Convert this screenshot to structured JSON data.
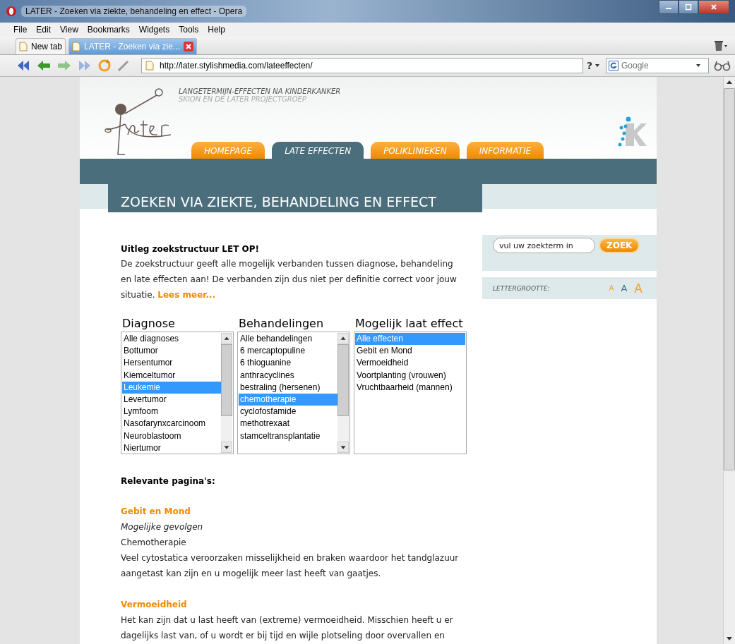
{
  "window": {
    "title": "LATER - Zoeken via ziekte, behandeling en effect - Opera"
  },
  "menu": [
    "File",
    "Edit",
    "View",
    "Bookmarks",
    "Widgets",
    "Tools",
    "Help"
  ],
  "browser_tabs": [
    {
      "label": "New tab",
      "selected": false
    },
    {
      "label": "LATER - Zoeken via zie...",
      "selected": true
    }
  ],
  "address": {
    "url": "http://later.stylishmedia.com/lateeffecten/"
  },
  "help_button": "?",
  "search": {
    "placeholder": "Google"
  },
  "site": {
    "tagline": "LANGETERMIJN-EFFECTEN NA KINDERKANKER",
    "subtagline": "SKION EN DE LATER PROJECTGROEP",
    "nav": [
      {
        "label": "HOMEPAGE",
        "selected": false
      },
      {
        "label": "LATE EFFECTEN",
        "selected": true
      },
      {
        "label": "POLIKLINIEKEN",
        "selected": false
      },
      {
        "label": "INFORMATIE",
        "selected": false
      }
    ],
    "page_title": "ZOEKEN VIA ZIEKTE, BEHANDELING EN EFFECT"
  },
  "intro": {
    "heading": "Uitleg zoekstructuur LET OP!",
    "text": "De zoekstructuur geeft alle mogelijk verbanden tussen diagnose, behandeling en late effecten aan! De verbanden zijn dus niet per definitie correct voor jouw situatie.",
    "link": "Lees meer..."
  },
  "sidebar": {
    "search_placeholder": "vul uw zoekterm in",
    "search_button": "ZOEK",
    "font_size_label": "LETTERGROOTTE:",
    "font_sizes": [
      {
        "label": "A",
        "kind": "small",
        "selected": false
      },
      {
        "label": "A",
        "kind": "medium",
        "selected": true
      },
      {
        "label": "A",
        "kind": "large",
        "selected": false
      }
    ]
  },
  "lists": [
    {
      "label": "Diagnose",
      "items": [
        {
          "text": "Alle diagnoses",
          "selected": false
        },
        {
          "text": "Bottumor",
          "selected": false
        },
        {
          "text": "Hersentumor",
          "selected": false
        },
        {
          "text": "Kiemceltumor",
          "selected": false
        },
        {
          "text": "Leukemie",
          "selected": true
        },
        {
          "text": "Levertumor",
          "selected": false
        },
        {
          "text": "Lymfoom",
          "selected": false
        },
        {
          "text": "Nasofarynxcarcinoom",
          "selected": false
        },
        {
          "text": "Neuroblastoom",
          "selected": false
        },
        {
          "text": "Niertumor",
          "selected": false
        }
      ]
    },
    {
      "label": "Behandelingen",
      "items": [
        {
          "text": "Alle behandelingen",
          "selected": false
        },
        {
          "text": "6 mercaptopuline",
          "selected": false
        },
        {
          "text": "6 thioguanine",
          "selected": false
        },
        {
          "text": "anthracyclines",
          "selected": false
        },
        {
          "text": "bestraling (hersenen)",
          "selected": false
        },
        {
          "text": "chemotherapie",
          "selected": true
        },
        {
          "text": "cyclofosfamide",
          "selected": false
        },
        {
          "text": "methotrexaat",
          "selected": false
        },
        {
          "text": "stamceltransplantatie",
          "selected": false
        }
      ]
    },
    {
      "label": "Mogelijk laat effect",
      "items": [
        {
          "text": "Alle effecten",
          "selected": true
        },
        {
          "text": "Gebit en Mond",
          "selected": false
        },
        {
          "text": "Vermoeidheid",
          "selected": false
        },
        {
          "text": "Voortplanting (vrouwen)",
          "selected": false
        },
        {
          "text": "Vruchtbaarheid (mannen)",
          "selected": false
        }
      ]
    }
  ],
  "relevant": {
    "heading": "Relevante pagina's:",
    "sections": [
      {
        "title": "Gebit en Mond",
        "lines": [
          {
            "kind": "italic",
            "text": "Mogelijke gevolgen"
          },
          {
            "kind": "plain",
            "text": "Chemotherapie"
          },
          {
            "kind": "plain",
            "text": "Veel cytostatica veroorzaken misselijkheid en braken waardoor het tandglazuur aangetast kan zijn en u mogelijk meer last heeft van gaatjes."
          }
        ]
      },
      {
        "title": "Vermoeidheid",
        "lines": [
          {
            "kind": "plain",
            "text": "Het kan zijn dat u last heeft van (extreme) vermoeidheid. Misschien heeft u er dagelijks last van, of u wordt er bij tijd en wijle plotseling door overvallen en"
          }
        ]
      }
    ]
  }
}
